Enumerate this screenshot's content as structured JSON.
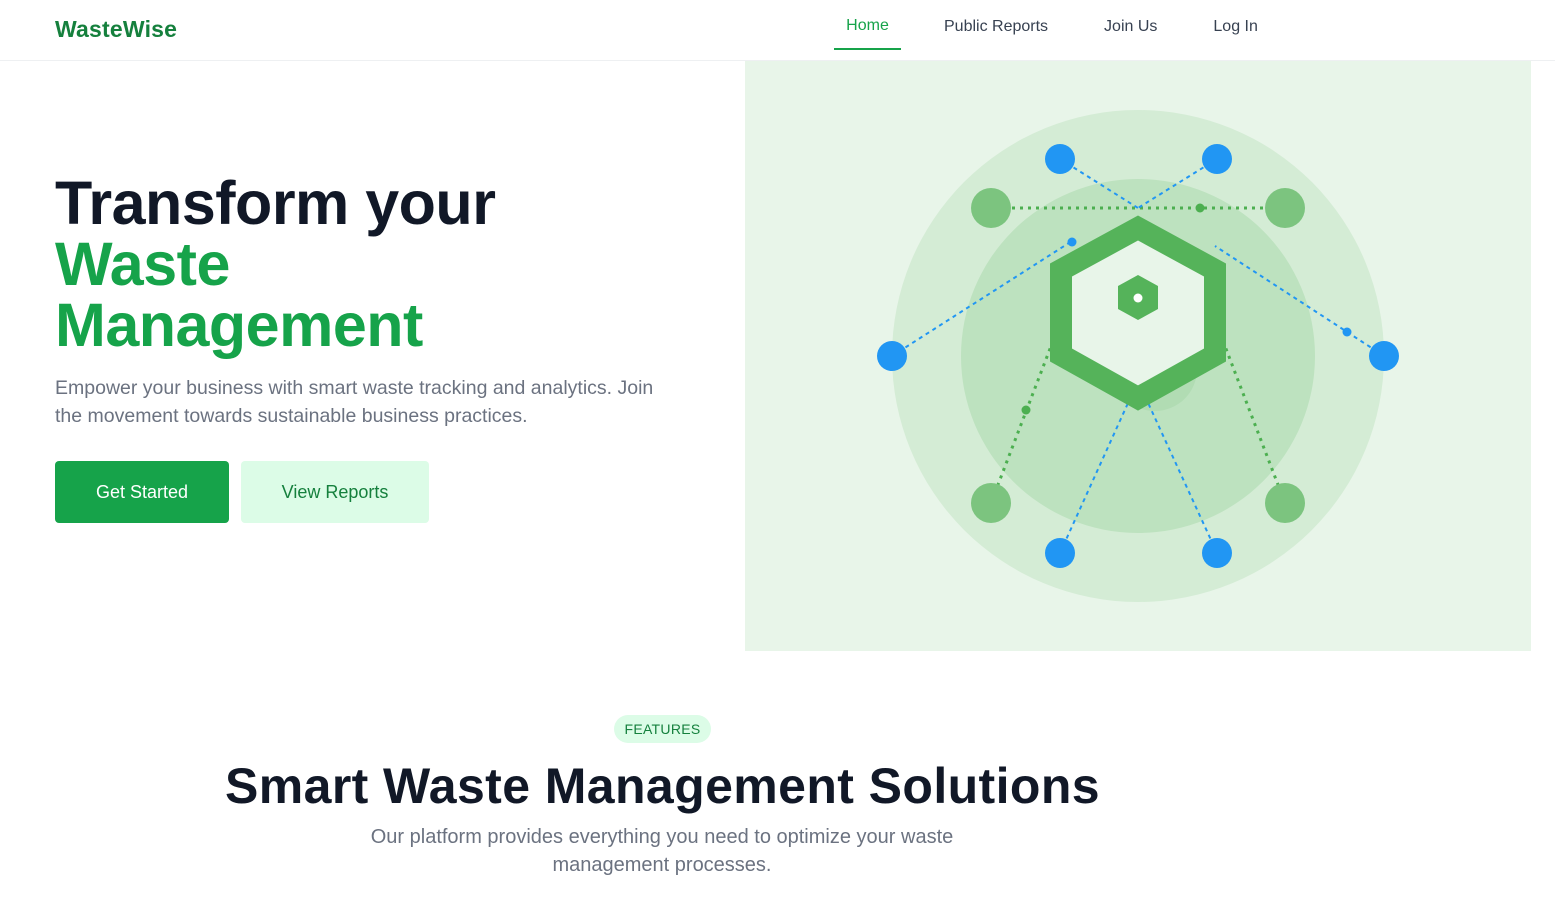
{
  "header": {
    "logo": "WasteWise",
    "nav": [
      {
        "label": "Home",
        "active": true
      },
      {
        "label": "Public Reports",
        "active": false
      },
      {
        "label": "Join Us",
        "active": false
      },
      {
        "label": "Log In",
        "active": false
      }
    ]
  },
  "hero": {
    "title_line1": "Transform your",
    "title_green1": "Waste",
    "title_green2": "Management",
    "subtitle": "Empower your business with smart waste tracking and analytics. Join the movement towards sustainable business practices.",
    "primary_button": "Get Started",
    "secondary_button": "View Reports"
  },
  "features": {
    "badge": "FEATURES",
    "title": "Smart Waste Management Solutions",
    "subtitle": "Our platform provides everything you need to optimize your waste management processes."
  },
  "colors": {
    "brand": "#16a34a",
    "brand_dark": "#15803d",
    "accent_blue": "#2196f3",
    "light_green": "#dcfce7"
  }
}
